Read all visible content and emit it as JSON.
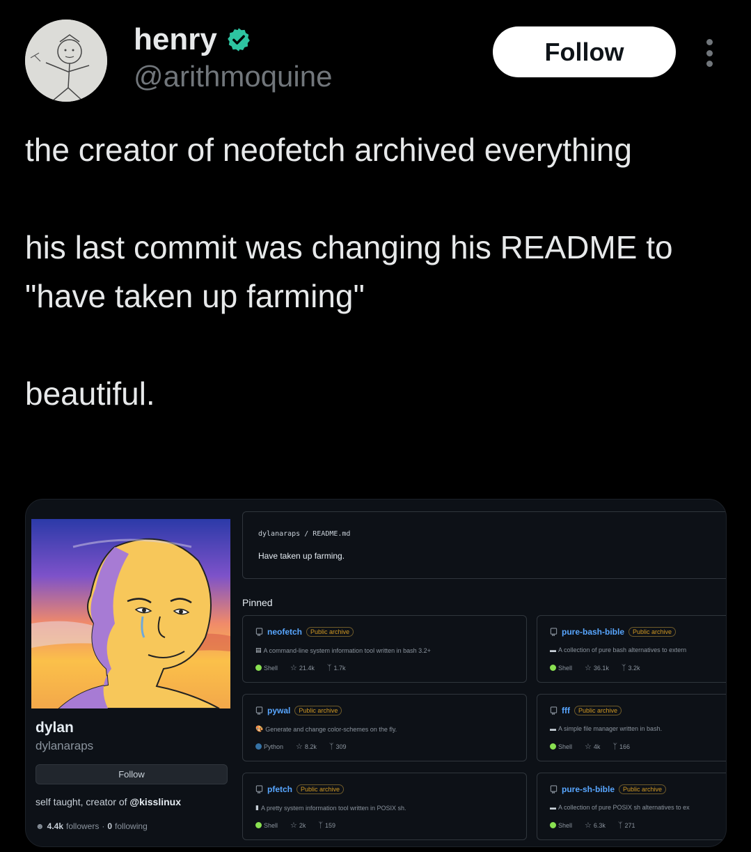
{
  "tweet": {
    "author_name": "henry",
    "handle": "@arithmoquine",
    "follow_label": "Follow",
    "paragraphs": [
      "the creator of neofetch archived everything",
      "his last commit was changing his README to \"have taken up farming\"",
      "beautiful."
    ]
  },
  "github": {
    "name": "dylan",
    "username": "dylanaraps",
    "follow_label": "Follow",
    "bio_prefix": "self taught, creator of",
    "bio_mention": "@kisslinux",
    "followers": "4.4k",
    "followers_label": "followers",
    "separator": "·",
    "following": "0",
    "following_label": "following",
    "readme_path": "dylanaraps / README.md",
    "readme_text": "Have taken up farming.",
    "pinned_label": "Pinned",
    "repos": [
      {
        "name": "neofetch",
        "badge": "Public archive",
        "desc": "A command-line system information tool written in bash 3.2+",
        "desc_glyph": "▤",
        "language": "Shell",
        "lang_color": "#89e051",
        "stars": "21.4k",
        "forks": "1.7k"
      },
      {
        "name": "pure-bash-bible",
        "badge": "Public archive",
        "desc": "A collection of pure bash alternatives to extern",
        "desc_glyph": "▬",
        "language": "Shell",
        "lang_color": "#89e051",
        "stars": "36.1k",
        "forks": "3.2k"
      },
      {
        "name": "pywal",
        "badge": "Public archive",
        "desc": "Generate and change color-schemes on the fly.",
        "desc_glyph": "🎨",
        "language": "Python",
        "lang_color": "#3572A5",
        "stars": "8.2k",
        "forks": "309"
      },
      {
        "name": "fff",
        "badge": "Public archive",
        "desc": "A simple file manager written in bash.",
        "desc_glyph": "▬",
        "language": "Shell",
        "lang_color": "#89e051",
        "stars": "4k",
        "forks": "166"
      },
      {
        "name": "pfetch",
        "badge": "Public archive",
        "desc": "A pretty system information tool written in POSIX sh.",
        "desc_glyph": "▮",
        "language": "Shell",
        "lang_color": "#89e051",
        "stars": "2k",
        "forks": "159"
      },
      {
        "name": "pure-sh-bible",
        "badge": "Public archive",
        "desc": "A collection of pure POSIX sh alternatives to ex",
        "desc_glyph": "▬",
        "language": "Shell",
        "lang_color": "#89e051",
        "stars": "6.3k",
        "forks": "271"
      }
    ]
  },
  "colors": {
    "background": "#000000",
    "verified": "#2ec4a1",
    "link": "#58a6ff",
    "badge": "#d29922"
  }
}
